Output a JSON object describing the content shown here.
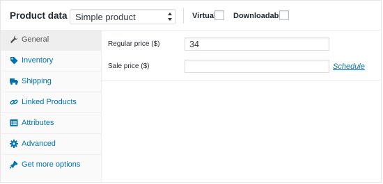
{
  "header": {
    "title": "Product data —",
    "product_type": {
      "selected": "Simple product"
    },
    "virtual_label": "Virtual:",
    "downloadable_label": "Downloadable:"
  },
  "tabs": [
    {
      "label": "General",
      "icon": "wrench-icon",
      "active": true
    },
    {
      "label": "Inventory",
      "icon": "tag-icon",
      "active": false
    },
    {
      "label": "Shipping",
      "icon": "truck-icon",
      "active": false
    },
    {
      "label": "Linked Products",
      "icon": "link-icon",
      "active": false
    },
    {
      "label": "Attributes",
      "icon": "list-icon",
      "active": false
    },
    {
      "label": "Advanced",
      "icon": "gear-icon",
      "active": false
    },
    {
      "label": "Get more options",
      "icon": "plugin-icon",
      "active": false
    }
  ],
  "general": {
    "regular_price_label": "Regular price ($)",
    "regular_price_value": "34",
    "sale_price_label": "Sale price ($)",
    "sale_price_value": "",
    "schedule_link": "Schedule"
  },
  "colors": {
    "link": "#0073aa",
    "active_tab_bg": "#eeeeee",
    "sidebar_bg": "#fafafa"
  }
}
